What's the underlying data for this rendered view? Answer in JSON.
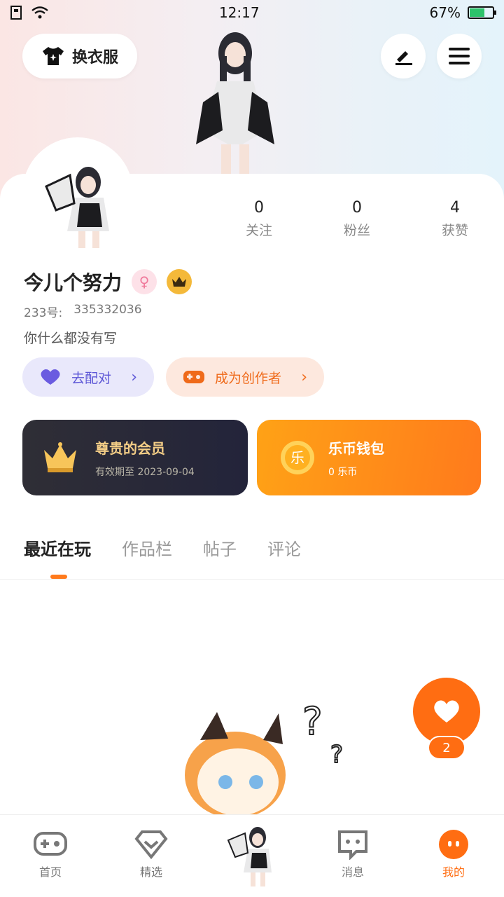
{
  "status_bar": {
    "time": "12:17",
    "battery": "67%"
  },
  "header": {
    "dress_label": "换衣服"
  },
  "stats": [
    {
      "value": "0",
      "label": "关注"
    },
    {
      "value": "0",
      "label": "粉丝"
    },
    {
      "value": "4",
      "label": "获赞"
    }
  ],
  "profile": {
    "name": "今儿个努力",
    "id_label": "233号:",
    "id_value": "335332036",
    "bio": "你什么都没有写"
  },
  "pills": {
    "match": "去配对",
    "creator": "成为创作者"
  },
  "vip": {
    "title": "尊贵的会员",
    "subtitle": "有效期至 2023-09-04"
  },
  "wallet": {
    "title": "乐币钱包",
    "subtitle": "0 乐币",
    "coin_glyph": "乐"
  },
  "tabs": [
    "最近在玩",
    "作品栏",
    "帖子",
    "评论"
  ],
  "fab": {
    "count": "2"
  },
  "bottom_nav": [
    "首页",
    "精选",
    "",
    "消息",
    "我的"
  ],
  "colors": {
    "accent": "#ff6d12",
    "match": "#5c56d6",
    "gold": "#f3cd86"
  }
}
